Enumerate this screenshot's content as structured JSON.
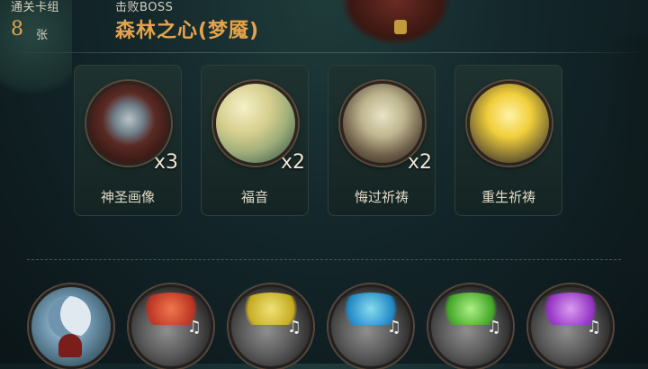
{
  "header": {
    "deck_label": "通关卡组",
    "deck_count": "8",
    "deck_unit": "张",
    "boss_label": "击败BOSS",
    "boss_name": "森林之心(梦魇)"
  },
  "cards": [
    {
      "name": "神圣画像",
      "count": "x3",
      "icon": "holy-portrait-icon"
    },
    {
      "name": "福音",
      "count": "x2",
      "icon": "gospel-cross-icon"
    },
    {
      "name": "悔过祈祷",
      "count": "x2",
      "icon": "repentance-prayer-icon"
    },
    {
      "name": "重生祈祷",
      "count": "",
      "icon": "rebirth-prayer-icon"
    }
  ],
  "relics": [
    {
      "icon": "moon-relic-icon"
    },
    {
      "icon": "skull-music-red-icon"
    },
    {
      "icon": "skull-music-yellow-icon"
    },
    {
      "icon": "skull-music-blue-icon"
    },
    {
      "icon": "skull-music-green-icon"
    },
    {
      "icon": "skull-music-purple-icon"
    }
  ],
  "relic_notes": [
    "♫",
    "♫",
    "♫",
    "♫",
    "♫"
  ]
}
